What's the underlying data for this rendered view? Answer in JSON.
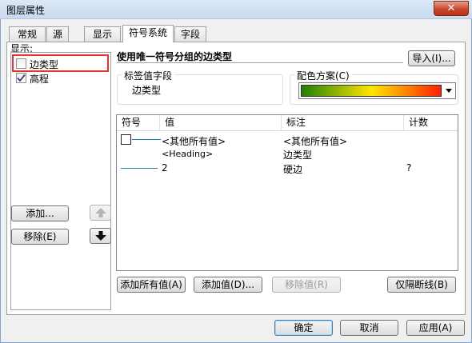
{
  "window": {
    "title": "图层属性",
    "close_glyph": "✕"
  },
  "tabs": [
    {
      "label": "常规"
    },
    {
      "label": "源"
    },
    {
      "label": "显示"
    },
    {
      "label": "符号系统",
      "active": true
    },
    {
      "label": "字段"
    }
  ],
  "left": {
    "show_label": "显示:",
    "items": [
      {
        "label": "边类型",
        "checked": false,
        "highlighted": true
      },
      {
        "label": "高程",
        "checked": true
      }
    ],
    "add_label": "添加...",
    "remove_label": "移除(E)",
    "up_icon": "arrow-up-icon",
    "down_icon": "arrow-down-icon"
  },
  "symbology": {
    "heading": "使用唯一符号分组的边类型",
    "import_label": "导入(I)...",
    "value_field_label": "标签值字段",
    "value_field_value": "边类型",
    "color_scheme_label": "配色方案(C)",
    "color_ramp": [
      "#208000",
      "#ffe600",
      "#ff2000"
    ]
  },
  "grid": {
    "headers": [
      "符号",
      "值",
      "标注",
      "计数"
    ],
    "rows": [
      {
        "symbol": "box-line",
        "value": "<其他所有值>",
        "label": "<其他所有值>",
        "count": ""
      },
      {
        "symbol": "none",
        "value": "<Heading>",
        "label": "边类型",
        "count": ""
      },
      {
        "symbol": "line",
        "value": "2",
        "label": "硬边",
        "count": "?"
      }
    ]
  },
  "buttons": {
    "add_all": "添加所有值(A)",
    "add_values": "添加值(D)...",
    "remove_value": "移除值(R)",
    "breaklines_only": "仅隔断线(B)",
    "ok": "确定",
    "cancel": "取消",
    "apply": "应用(A)"
  },
  "colors": {
    "accent": "#3c7fb1",
    "highlight": "#e63232",
    "symbol_line": "#1f7fa8"
  }
}
